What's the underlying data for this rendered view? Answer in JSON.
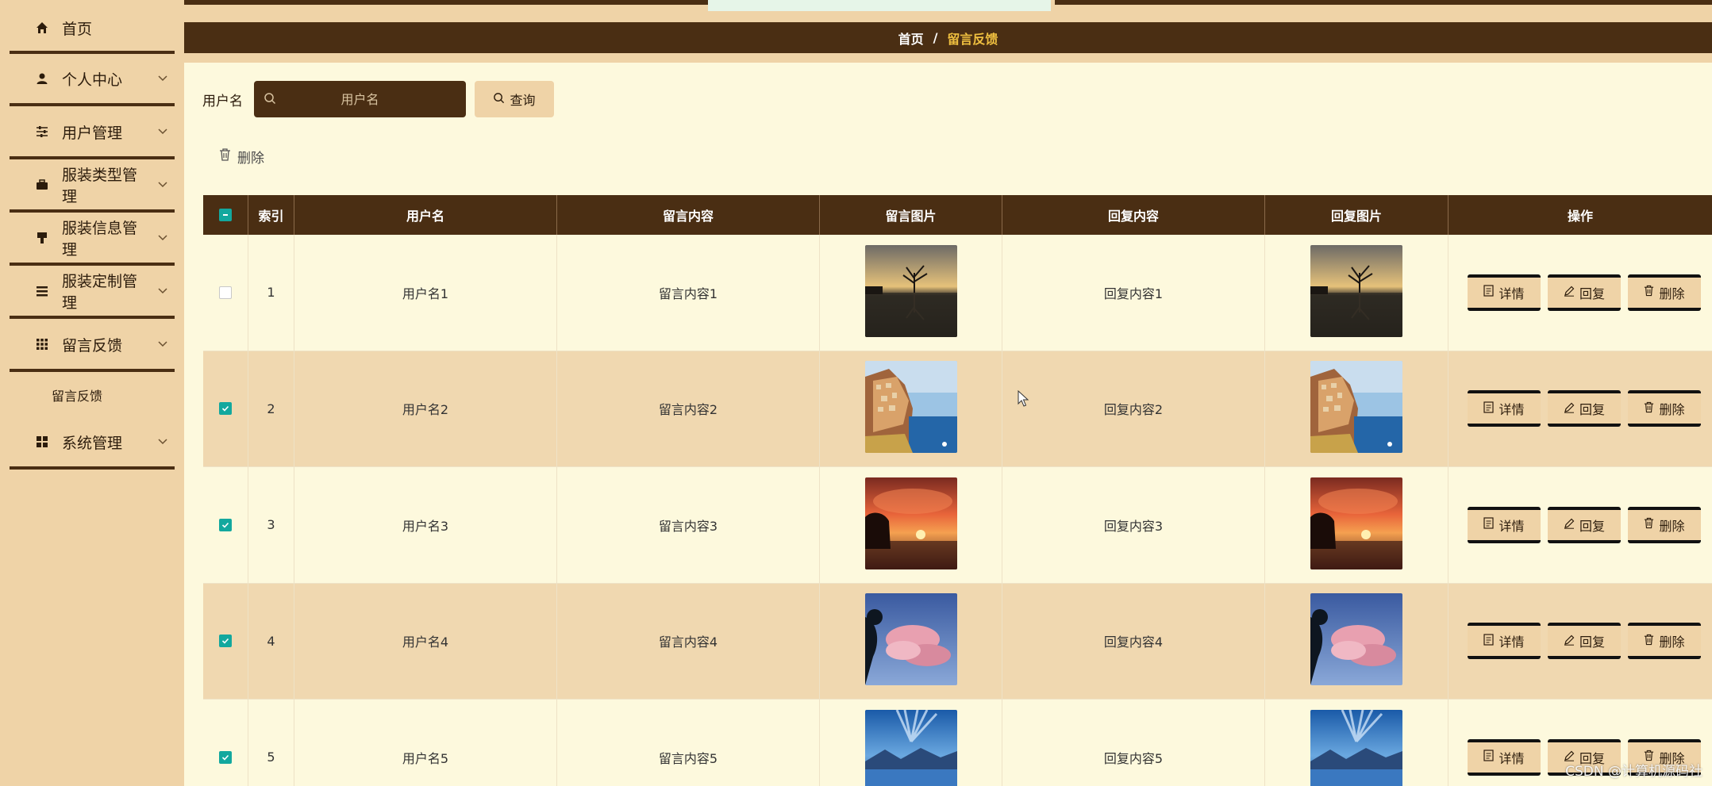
{
  "sidebar": {
    "items": [
      {
        "label": "首页",
        "icon": "home-icon"
      },
      {
        "label": "个人中心",
        "icon": "user-icon"
      },
      {
        "label": "用户管理",
        "icon": "sliders-icon"
      },
      {
        "label": "服装类型管理",
        "icon": "briefcase-icon"
      },
      {
        "label": "服装信息管理",
        "icon": "brush-icon"
      },
      {
        "label": "服装定制管理",
        "icon": "list-icon"
      },
      {
        "label": "留言反馈",
        "icon": "grid-icon"
      },
      {
        "label": "系统管理",
        "icon": "apps-icon"
      }
    ],
    "submenu": {
      "label": "留言反馈"
    }
  },
  "breadcrumb": {
    "home": "首页",
    "separator": "/",
    "current": "留言反馈"
  },
  "search": {
    "label": "用户名",
    "placeholder": "用户名",
    "button": "查询"
  },
  "toolbar": {
    "delete_label": "删除"
  },
  "table": {
    "headers": {
      "index": "索引",
      "username": "用户名",
      "message": "留言内容",
      "message_image": "留言图片",
      "reply": "回复内容",
      "reply_image": "回复图片",
      "ops": "操作"
    },
    "rows": [
      {
        "index": "1",
        "username": "用户名1",
        "message": "留言内容1",
        "reply": "回复内容1",
        "checked": false,
        "image": "lake-tree-sunset"
      },
      {
        "index": "2",
        "username": "用户名2",
        "message": "留言内容2",
        "reply": "回复内容2",
        "checked": true,
        "image": "cliff-village"
      },
      {
        "index": "3",
        "username": "用户名3",
        "message": "留言内容3",
        "reply": "回复内容3",
        "checked": true,
        "image": "orange-sunset"
      },
      {
        "index": "4",
        "username": "用户名4",
        "message": "留言内容4",
        "reply": "回复内容4",
        "checked": true,
        "image": "pink-clouds"
      },
      {
        "index": "5",
        "username": "用户名5",
        "message": "留言内容5",
        "reply": "回复内容5",
        "checked": true,
        "image": "blue-mountain-lake"
      }
    ],
    "actions": {
      "detail": "详情",
      "reply": "回复",
      "delete": "删除"
    }
  },
  "watermark": "CSDN @计算机源码社",
  "colors": {
    "sidebar_bg": "#efd3a7",
    "dark_brown": "#4a2e13",
    "page_bg": "#fdf9dd",
    "row_alt": "#f0d8b0",
    "accent_gold": "#f0c040",
    "check_teal": "#13a89e"
  }
}
